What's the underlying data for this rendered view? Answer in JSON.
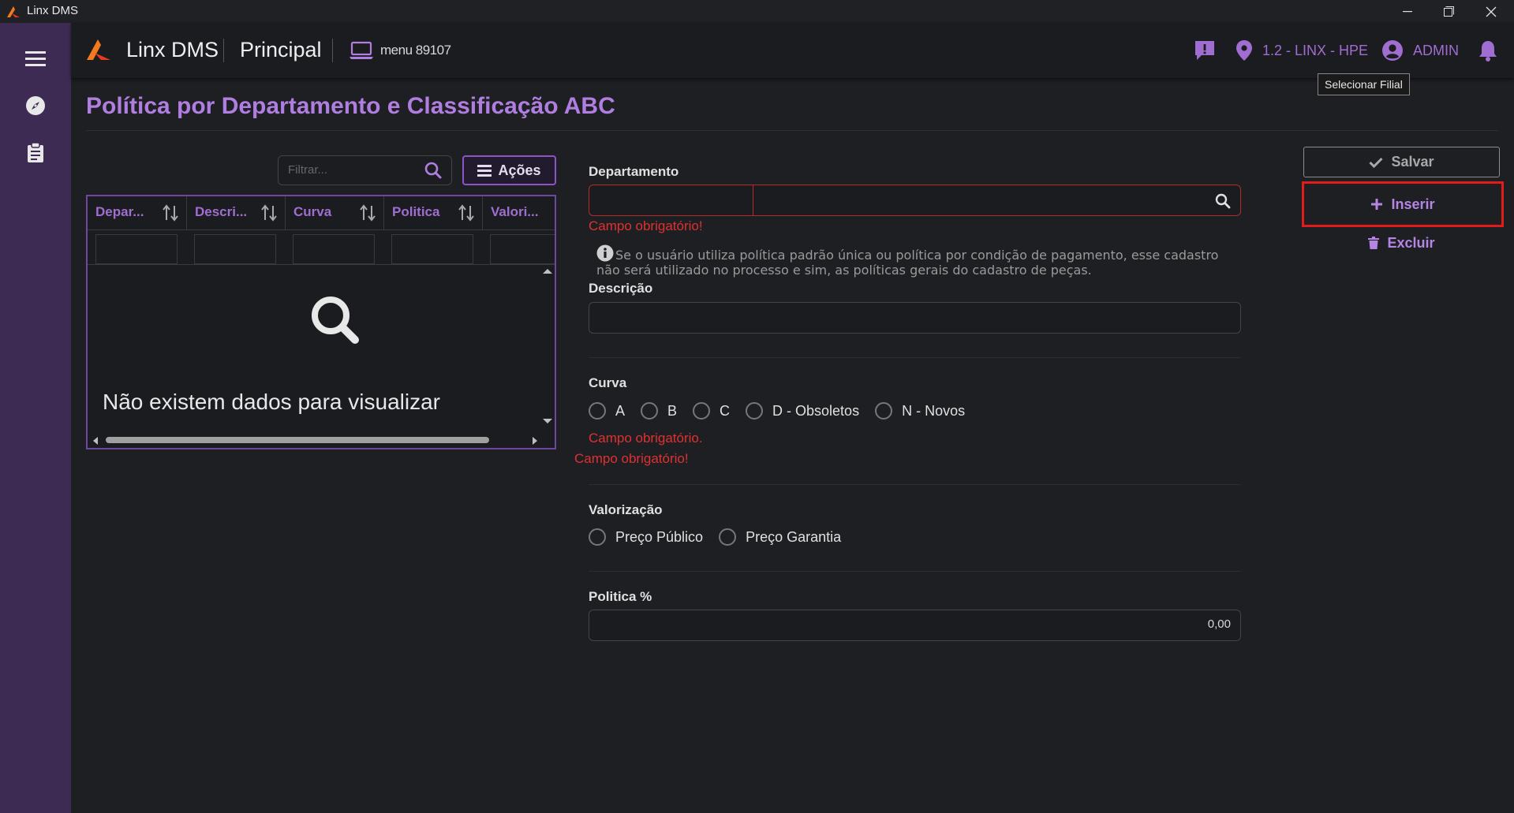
{
  "window": {
    "title": "Linx DMS"
  },
  "header": {
    "brand": "Linx DMS",
    "module": "Principal",
    "menu_label": "menu 89107",
    "filial": "1.2 - LINX - HPE",
    "user": "ADMIN",
    "notification_badge": "!",
    "tooltip": "Selecionar Filial"
  },
  "page": {
    "title": "Política por Departamento e Classificação ABC"
  },
  "grid": {
    "filter_placeholder": "Filtrar...",
    "actions_label": "Ações",
    "columns": [
      "Depar...",
      "Descri...",
      "Curva",
      "Politica",
      "Valori..."
    ],
    "empty_message": "Não existem dados para visualizar"
  },
  "form": {
    "departamento": {
      "label": "Departamento",
      "code_value": "",
      "name_value": "",
      "error": "Campo obrigatório!"
    },
    "info_text": "Se o usuário utiliza política padrão única ou política por condição de pagamento, esse cadastro não será utilizado no processo e sim, as políticas gerais do cadastro de peças.",
    "descricao": {
      "label": "Descrição",
      "value": ""
    },
    "curva": {
      "label": "Curva",
      "options": [
        "A",
        "B",
        "C",
        "D - Obsoletos",
        "N - Novos"
      ],
      "error1": "Campo obrigatório.",
      "error2": "Campo obrigatório!"
    },
    "valorizacao": {
      "label": "Valorização",
      "options": [
        "Preço Público",
        "Preço Garantia"
      ]
    },
    "politica": {
      "label": "Politica %",
      "value": "0,00"
    }
  },
  "actions": {
    "save": "Salvar",
    "insert": "Inserir",
    "delete": "Excluir"
  },
  "colors": {
    "accent": "#a06dd1",
    "sidebar": "#3e2b54",
    "error": "#e03131",
    "highlight_border": "#e21b1b"
  }
}
